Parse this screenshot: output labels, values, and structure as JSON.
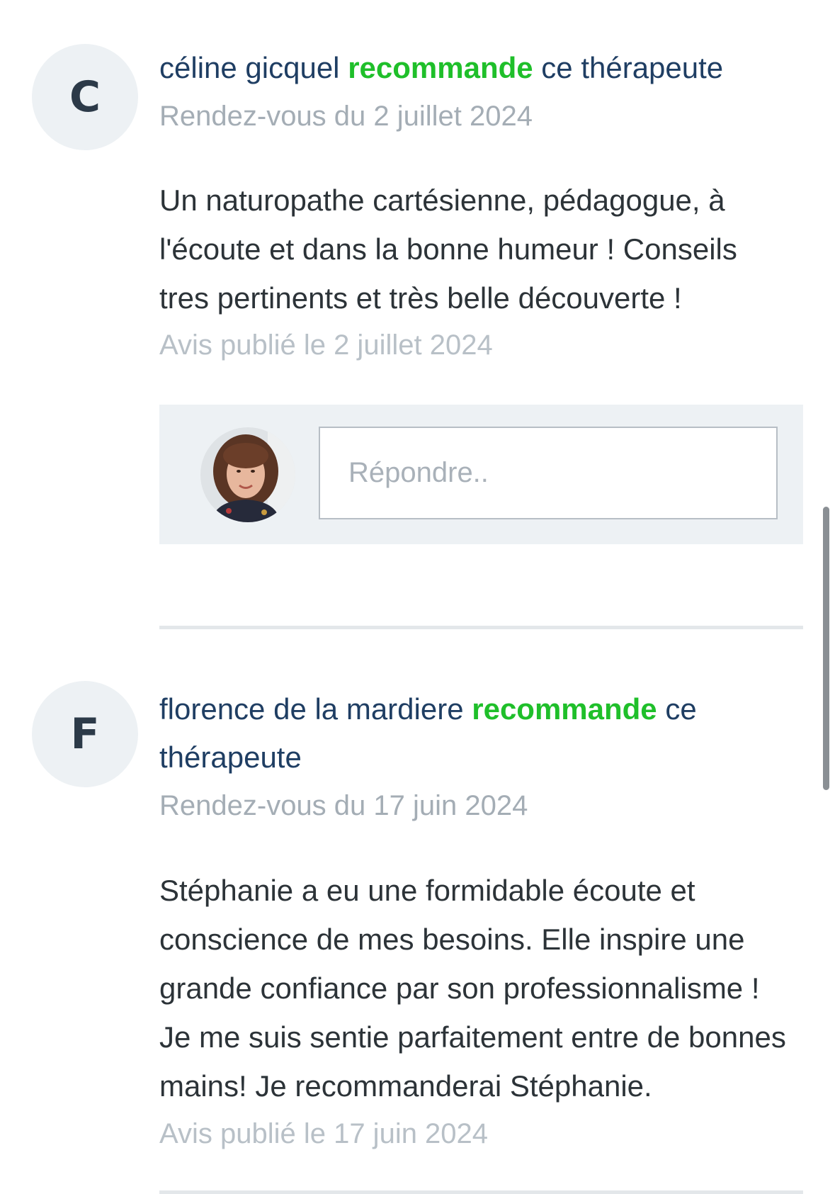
{
  "reviews": [
    {
      "initial": "C",
      "author": "céline gicquel",
      "verb": "recommande",
      "suffix": " ce thérapeute",
      "appointment": "Rendez-vous du 2 juillet 2024",
      "text": "Un naturopathe cartésienne, pédagogue, à l'écoute et dans la bonne humeur ! Conseils tres pertinents et très belle découverte !",
      "published": "Avis publié le 2 juillet 2024"
    },
    {
      "initial": "F",
      "author": "florence de la mardiere",
      "verb": "recommande",
      "suffix": " ce thérapeute",
      "appointment": "Rendez-vous du 17 juin 2024",
      "text": "Stéphanie a eu une formidable écoute et conscience de mes besoins. Elle inspire une grande confiance par son professionnalisme ! Je me suis sentie parfaitement entre de bonnes mains! Je recommanderai Stéphanie.",
      "published": "Avis publié le 17 juin 2024"
    }
  ],
  "reply": {
    "placeholder": "Répondre.."
  },
  "colors": {
    "name": "#1f3e63",
    "recommend": "#1fbf2a",
    "muted": "#a4adb5",
    "panel": "#edf1f4"
  }
}
